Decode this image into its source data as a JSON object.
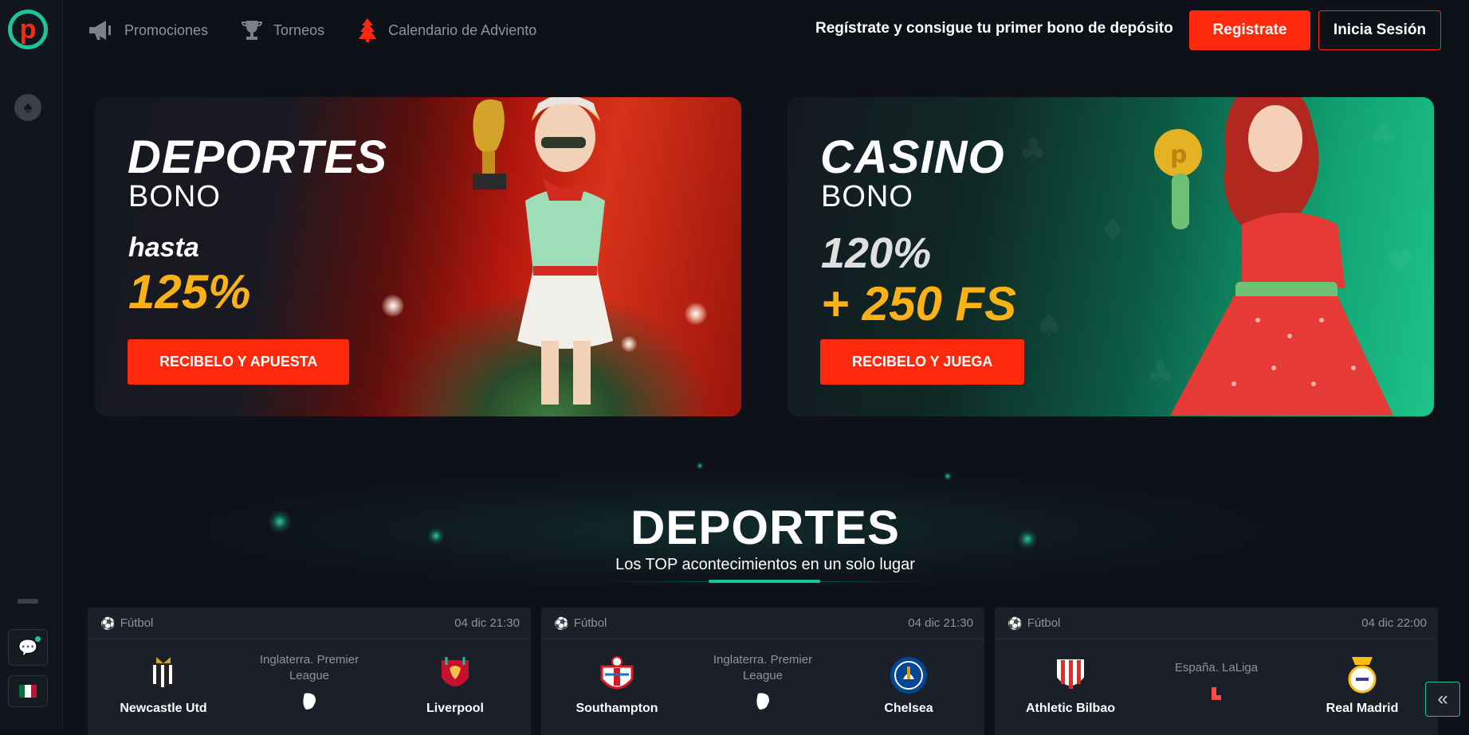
{
  "nav": {
    "items": [
      {
        "label": "Promociones",
        "icon": "megaphone-icon"
      },
      {
        "label": "Torneos",
        "icon": "trophy-icon"
      },
      {
        "label": "Calendario de Adviento",
        "icon": "christmas-tree-icon"
      }
    ]
  },
  "header": {
    "promo_text": "Regístrate y consigue tu primer bono de depósito",
    "register_label": "Registrate",
    "login_label": "Inicia Sesión"
  },
  "banners": {
    "sports": {
      "title": "DEPORTES",
      "subtitle": "BONO",
      "prefix": "hasta",
      "value": "125%",
      "button": "RECIBELO Y APUESTA"
    },
    "casino": {
      "title": "CASINO",
      "subtitle": "BONO",
      "value": "120%",
      "extra": "+ 250 FS",
      "button": "RECIBELO Y JUEGA"
    }
  },
  "section": {
    "title": "DEPORTES",
    "subtitle": "Los TOP acontecimientos en un solo lugar"
  },
  "matches": [
    {
      "sport": "Fútbol",
      "time": "04 dic 21:30",
      "league": "Inglaterra. Premier League",
      "home": "Newcastle Utd",
      "away": "Liverpool"
    },
    {
      "sport": "Fútbol",
      "time": "04 dic 21:30",
      "league": "Inglaterra. Premier League",
      "home": "Southampton",
      "away": "Chelsea"
    },
    {
      "sport": "Fútbol",
      "time": "04 dic 22:00",
      "league": "España. LaLiga",
      "home": "Athletic Bilbao",
      "away": "Real Madrid"
    }
  ],
  "colors": {
    "accent": "#ff2a0e",
    "brand_teal": "#1fc39a",
    "highlight_yellow": "#fbb216",
    "background": "#0e1218"
  }
}
